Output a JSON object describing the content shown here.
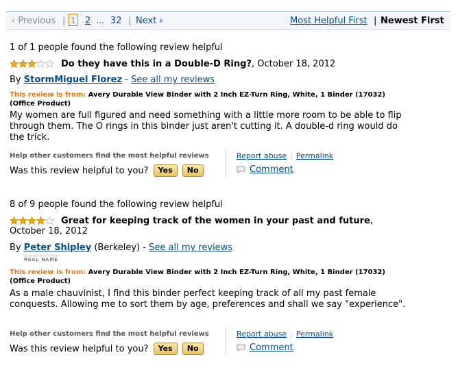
{
  "pager": {
    "previous": "‹ Previous",
    "sep": "|",
    "current": "1",
    "page2": "2",
    "ellipsis": "...",
    "last": "32",
    "next": "Next ›"
  },
  "sort": {
    "most_helpful": "Most Helpful First",
    "sep": "|",
    "newest": "Newest First"
  },
  "reviews": [
    {
      "helpful_count": "1 of 1 people found the following review helpful",
      "rating": 3,
      "title": "Do they have this in a Double-D Ring?",
      "date": ", October 18, 2012",
      "by": "By",
      "author": "StormMiguel Florez",
      "dash": "-",
      "location": "",
      "see_all": "See all my reviews",
      "real_name": "",
      "from_label": "This review is from:",
      "product": "Avery Durable View Binder with 2 Inch EZ-Turn Ring, White, 1 Binder (17032)",
      "category": "(Office Product)",
      "body": "My women are full figured and need something with a little more room to be able to flip through them. The O rings in this binder just aren't cutting it. A double-d ring would do the trick.",
      "help_label": "Help other customers find the most helpful reviews",
      "question": "Was this review helpful to you?",
      "yes": "Yes",
      "no": "No",
      "report": "Report abuse",
      "permalink": "Permalink",
      "comment": "Comment"
    },
    {
      "helpful_count": "8 of 9 people found the following review helpful",
      "rating": 4,
      "title": "Great for keeping track of the women in your past and future",
      "date": ",",
      "date2": "October 18, 2012",
      "by": "By",
      "author": "Peter Shipley",
      "location": "(Berkeley)",
      "dash": "-",
      "see_all": "See all my reviews",
      "real_name": "REAL NAME",
      "from_label": "This review is from:",
      "product": "Avery Durable View Binder with 2 Inch EZ-Turn Ring, White, 1 Binder (17032)",
      "category": "(Office Product)",
      "body": "As a male chauvinist, I find this binder perfect keeping track of all my past female conquests. Allowing me to sort them by age, preferences and shall we say \"experience\".",
      "help_label": "Help other customers find the most helpful reviews",
      "question": "Was this review helpful to you?",
      "yes": "Yes",
      "no": "No",
      "report": "Report abuse",
      "permalink": "Permalink",
      "comment": "Comment"
    }
  ],
  "colors": {
    "link": "#004b91",
    "star_filled": "#f0a800",
    "from_label": "#e47911"
  }
}
